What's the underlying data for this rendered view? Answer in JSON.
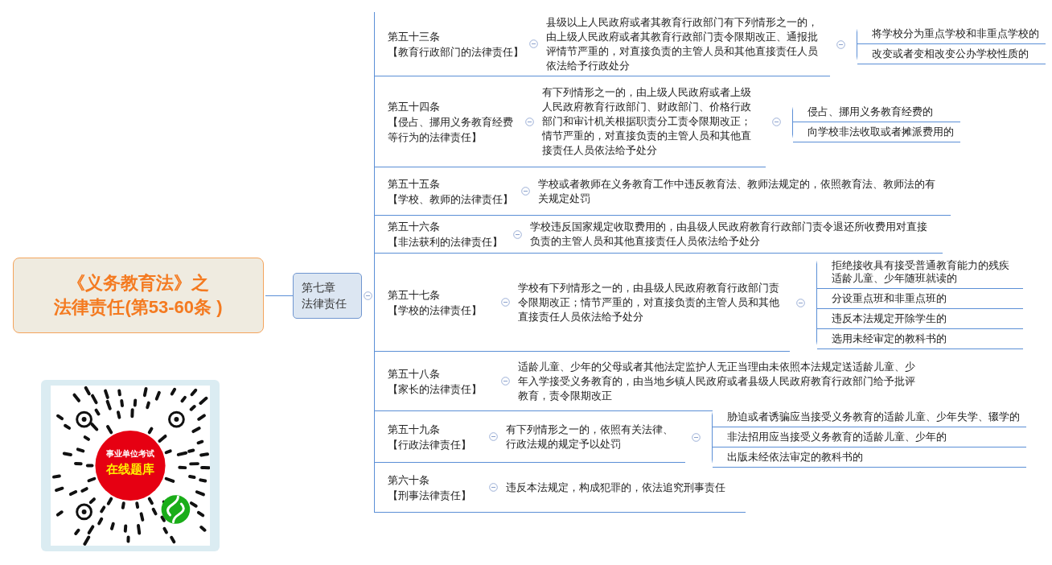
{
  "root": {
    "lines": [
      "《义务教育法》之",
      "法律责任(第53-60条 )"
    ]
  },
  "chapter": {
    "lines": [
      "第七章",
      "法律责任"
    ]
  },
  "articles": [
    {
      "number": "第五十三条",
      "title": "【教育行政部门的法律责任】",
      "text": "县级以上人民政府或者其教育行政部门有下列情形之一的，由上级人民政府或者其教育行政部门责令限期改正、通报批评情节严重的，对直接负责的主管人员和其他直接责任人员依法给予行政处分",
      "children": [
        "将学校分为重点学校和非重点学校的",
        "改变或者变相改变公办学校性质的"
      ]
    },
    {
      "number": "第五十四条",
      "title": "【侵占、挪用义务教育经费等行为的法律责任】",
      "text": "有下列情形之一的，由上级人民政府或者上级人民政府教育行政部门、财政部门、价格行政部门和审计机关根据职责分工责令限期改正；情节严重的，对直接负责的主管人员和其他直接责任人员依法给予处分",
      "children": [
        "侵占、挪用义务教育经费的",
        "向学校非法收取或者摊派费用的"
      ]
    },
    {
      "number": "第五十五条",
      "title": "【学校、教师的法律责任】",
      "text": "学校或者教师在义务教育工作中违反教育法、教师法规定的，依照教育法、教师法的有关规定处罚"
    },
    {
      "number": "第五十六条",
      "title": "【非法获利的法律责任】",
      "text": "学校违反国家规定收取费用的，由县级人民政府教育行政部门责令退还所收费用对直接负责的主管人员和其他直接责任人员依法给予处分"
    },
    {
      "number": "第五十七条",
      "title": "【学校的法律责任】",
      "text": "学校有下列情形之一的，由县级人民政府教育行政部门责令限期改正；情节严重的，对直接负责的主管人员和其他直接责任人员依法给予处分",
      "children": [
        "拒绝接收具有接受普通教育能力的残疾适龄儿童、少年随班就读的",
        "分设重点班和非重点班的",
        "违反本法规定开除学生的",
        "选用未经审定的教科书的"
      ]
    },
    {
      "number": "第五十八条",
      "title": "【家长的法律责任】",
      "text": "适龄儿童、少年的父母或者其他法定监护人无正当理由未依照本法规定送适龄儿童、少年入学接受义务教育的，由当地乡镇人民政府或者县级人民政府教育行政部门给予批评教育，责令限期改正"
    },
    {
      "number": "第五十九条",
      "title": "【行政法律责任】",
      "text": "有下列情形之一的，依照有关法律、行政法规的规定予以处罚",
      "children": [
        "胁迫或者诱骗应当接受义务教育的适龄儿童、少年失学、辍学的",
        "非法招用应当接受义务教育的适龄儿童、少年的",
        "出版未经依法审定的教科书的"
      ]
    },
    {
      "number": "第六十条",
      "title": "【刑事法律责任】",
      "text": "违反本法规定，构成犯罪的，依法追究刑事责任"
    }
  ],
  "qr": {
    "caption": "事业单位考试",
    "label": "在线题库"
  }
}
